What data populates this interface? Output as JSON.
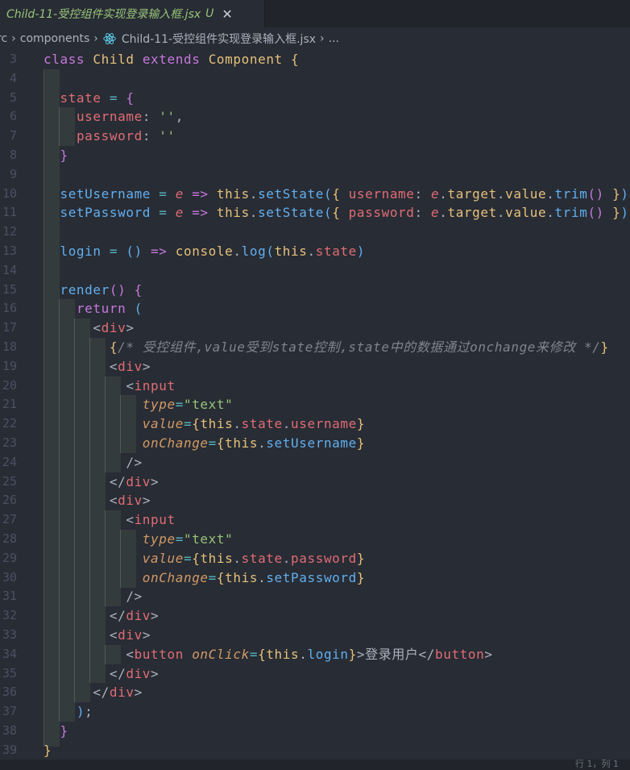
{
  "tab": {
    "title": "Child-11-受控组件实现登录输入框.jsx",
    "status": "U",
    "close_icon": "close-icon"
  },
  "breadcrumb": {
    "items": [
      "rc",
      "components",
      "Child-11-受控组件实现登录输入框.jsx",
      "..."
    ],
    "file_icon": "react-icon"
  },
  "status_bar": {
    "text": "行 1，列 1"
  },
  "editor": {
    "lines": [
      {
        "n": "3",
        "tokens": [
          [
            "k",
            "class "
          ],
          [
            "c",
            "Child "
          ],
          [
            "k",
            "extends "
          ],
          [
            "c",
            "Component "
          ],
          [
            "b1",
            "{"
          ]
        ]
      },
      {
        "n": "4",
        "tokens": []
      },
      {
        "n": "5",
        "tokens": [
          [
            "pl",
            "  "
          ],
          [
            "v",
            "state "
          ],
          [
            "o",
            "= "
          ],
          [
            "b2",
            "{"
          ]
        ]
      },
      {
        "n": "6",
        "tokens": [
          [
            "pl",
            "    "
          ],
          [
            "v",
            "username"
          ],
          [
            "pl",
            ": "
          ],
          [
            "s",
            "''"
          ],
          [
            "pl",
            ","
          ]
        ]
      },
      {
        "n": "7",
        "tokens": [
          [
            "pl",
            "    "
          ],
          [
            "v",
            "password"
          ],
          [
            "pl",
            ": "
          ],
          [
            "s",
            "''"
          ]
        ]
      },
      {
        "n": "8",
        "tokens": [
          [
            "pl",
            "  "
          ],
          [
            "b2",
            "}"
          ]
        ]
      },
      {
        "n": "9",
        "tokens": []
      },
      {
        "n": "10",
        "tokens": [
          [
            "pl",
            "  "
          ],
          [
            "f",
            "setUsername "
          ],
          [
            "o",
            "= "
          ],
          [
            "p",
            "e"
          ],
          [
            "k",
            " => "
          ],
          [
            "c",
            "this"
          ],
          [
            "pl",
            "."
          ],
          [
            "f",
            "setState"
          ],
          [
            "b3",
            "("
          ],
          [
            "b1",
            "{ "
          ],
          [
            "v",
            "username"
          ],
          [
            "pl",
            ": "
          ],
          [
            "p",
            "e"
          ],
          [
            "pl",
            "."
          ],
          [
            "c",
            "target"
          ],
          [
            "pl",
            "."
          ],
          [
            "c",
            "value"
          ],
          [
            "pl",
            "."
          ],
          [
            "f",
            "trim"
          ],
          [
            "b2",
            "() "
          ],
          [
            "b1",
            "}"
          ],
          [
            "b3",
            ")"
          ]
        ]
      },
      {
        "n": "11",
        "tokens": [
          [
            "pl",
            "  "
          ],
          [
            "f",
            "setPassword "
          ],
          [
            "o",
            "= "
          ],
          [
            "p",
            "e"
          ],
          [
            "k",
            " => "
          ],
          [
            "c",
            "this"
          ],
          [
            "pl",
            "."
          ],
          [
            "f",
            "setState"
          ],
          [
            "b3",
            "("
          ],
          [
            "b1",
            "{ "
          ],
          [
            "v",
            "password"
          ],
          [
            "pl",
            ": "
          ],
          [
            "p",
            "e"
          ],
          [
            "pl",
            "."
          ],
          [
            "c",
            "target"
          ],
          [
            "pl",
            "."
          ],
          [
            "c",
            "value"
          ],
          [
            "pl",
            "."
          ],
          [
            "f",
            "trim"
          ],
          [
            "b2",
            "() "
          ],
          [
            "b1",
            "}"
          ],
          [
            "b3",
            ")"
          ]
        ]
      },
      {
        "n": "12",
        "tokens": []
      },
      {
        "n": "13",
        "tokens": [
          [
            "pl",
            "  "
          ],
          [
            "f",
            "login "
          ],
          [
            "o",
            "= "
          ],
          [
            "b3",
            "() "
          ],
          [
            "k",
            "=> "
          ],
          [
            "c",
            "console"
          ],
          [
            "pl",
            "."
          ],
          [
            "f",
            "log"
          ],
          [
            "b3",
            "("
          ],
          [
            "c",
            "this"
          ],
          [
            "pl",
            "."
          ],
          [
            "v",
            "state"
          ],
          [
            "b3",
            ")"
          ]
        ]
      },
      {
        "n": "14",
        "tokens": []
      },
      {
        "n": "15",
        "tokens": [
          [
            "pl",
            "  "
          ],
          [
            "f",
            "render"
          ],
          [
            "b2",
            "() "
          ],
          [
            "b2",
            "{"
          ]
        ]
      },
      {
        "n": "16",
        "tokens": [
          [
            "pl",
            "    "
          ],
          [
            "k",
            "return "
          ],
          [
            "b3",
            "("
          ]
        ]
      },
      {
        "n": "17",
        "tokens": [
          [
            "pl",
            "      "
          ],
          [
            "pl",
            "<"
          ],
          [
            "t",
            "div"
          ],
          [
            "pl",
            ">"
          ]
        ]
      },
      {
        "n": "18",
        "tokens": [
          [
            "pl",
            "        "
          ],
          [
            "b1",
            "{"
          ],
          [
            "cm",
            "/* 受控组件,value受到state控制,state中的数据通过onchange来修改 */"
          ],
          [
            "b1",
            "}"
          ]
        ]
      },
      {
        "n": "19",
        "tokens": [
          [
            "pl",
            "        "
          ],
          [
            "pl",
            "<"
          ],
          [
            "t",
            "div"
          ],
          [
            "pl",
            ">"
          ]
        ]
      },
      {
        "n": "20",
        "tokens": [
          [
            "pl",
            "          "
          ],
          [
            "pl",
            "<"
          ],
          [
            "t",
            "input"
          ]
        ]
      },
      {
        "n": "21",
        "tokens": [
          [
            "pl",
            "            "
          ],
          [
            "a",
            "type"
          ],
          [
            "o",
            "="
          ],
          [
            "s",
            "\"text\""
          ]
        ]
      },
      {
        "n": "22",
        "tokens": [
          [
            "pl",
            "            "
          ],
          [
            "a",
            "value"
          ],
          [
            "o",
            "="
          ],
          [
            "b1",
            "{"
          ],
          [
            "c",
            "this"
          ],
          [
            "pl",
            "."
          ],
          [
            "v",
            "state"
          ],
          [
            "pl",
            "."
          ],
          [
            "v",
            "username"
          ],
          [
            "b1",
            "}"
          ]
        ]
      },
      {
        "n": "23",
        "tokens": [
          [
            "pl",
            "            "
          ],
          [
            "a",
            "onChange"
          ],
          [
            "o",
            "="
          ],
          [
            "b1",
            "{"
          ],
          [
            "c",
            "this"
          ],
          [
            "pl",
            "."
          ],
          [
            "f",
            "setUsername"
          ],
          [
            "b1",
            "}"
          ]
        ]
      },
      {
        "n": "24",
        "tokens": [
          [
            "pl",
            "          "
          ],
          [
            "pl",
            "/>"
          ]
        ]
      },
      {
        "n": "25",
        "tokens": [
          [
            "pl",
            "        "
          ],
          [
            "pl",
            "</"
          ],
          [
            "t",
            "div"
          ],
          [
            "pl",
            ">"
          ]
        ]
      },
      {
        "n": "26",
        "tokens": [
          [
            "pl",
            "        "
          ],
          [
            "pl",
            "<"
          ],
          [
            "t",
            "div"
          ],
          [
            "pl",
            ">"
          ]
        ]
      },
      {
        "n": "27",
        "tokens": [
          [
            "pl",
            "          "
          ],
          [
            "pl",
            "<"
          ],
          [
            "t",
            "input"
          ]
        ]
      },
      {
        "n": "28",
        "tokens": [
          [
            "pl",
            "            "
          ],
          [
            "a",
            "type"
          ],
          [
            "o",
            "="
          ],
          [
            "s",
            "\"text\""
          ]
        ]
      },
      {
        "n": "29",
        "tokens": [
          [
            "pl",
            "            "
          ],
          [
            "a",
            "value"
          ],
          [
            "o",
            "="
          ],
          [
            "b1",
            "{"
          ],
          [
            "c",
            "this"
          ],
          [
            "pl",
            "."
          ],
          [
            "v",
            "state"
          ],
          [
            "pl",
            "."
          ],
          [
            "v",
            "password"
          ],
          [
            "b1",
            "}"
          ]
        ]
      },
      {
        "n": "30",
        "tokens": [
          [
            "pl",
            "            "
          ],
          [
            "a",
            "onChange"
          ],
          [
            "o",
            "="
          ],
          [
            "b1",
            "{"
          ],
          [
            "c",
            "this"
          ],
          [
            "pl",
            "."
          ],
          [
            "f",
            "setPassword"
          ],
          [
            "b1",
            "}"
          ]
        ]
      },
      {
        "n": "31",
        "tokens": [
          [
            "pl",
            "          "
          ],
          [
            "pl",
            "/>"
          ]
        ]
      },
      {
        "n": "32",
        "tokens": [
          [
            "pl",
            "        "
          ],
          [
            "pl",
            "</"
          ],
          [
            "t",
            "div"
          ],
          [
            "pl",
            ">"
          ]
        ]
      },
      {
        "n": "33",
        "tokens": [
          [
            "pl",
            "        "
          ],
          [
            "pl",
            "<"
          ],
          [
            "t",
            "div"
          ],
          [
            "pl",
            ">"
          ]
        ]
      },
      {
        "n": "34",
        "tokens": [
          [
            "pl",
            "          "
          ],
          [
            "pl",
            "<"
          ],
          [
            "t",
            "button "
          ],
          [
            "a",
            "onClick"
          ],
          [
            "o",
            "="
          ],
          [
            "b1",
            "{"
          ],
          [
            "c",
            "this"
          ],
          [
            "pl",
            "."
          ],
          [
            "f",
            "login"
          ],
          [
            "b1",
            "}"
          ],
          [
            "pl",
            ">"
          ],
          [
            "tx",
            "登录用户"
          ],
          [
            "pl",
            "</"
          ],
          [
            "t",
            "button"
          ],
          [
            "pl",
            ">"
          ]
        ]
      },
      {
        "n": "35",
        "tokens": [
          [
            "pl",
            "        "
          ],
          [
            "pl",
            "</"
          ],
          [
            "t",
            "div"
          ],
          [
            "pl",
            ">"
          ]
        ]
      },
      {
        "n": "36",
        "tokens": [
          [
            "pl",
            "      "
          ],
          [
            "pl",
            "</"
          ],
          [
            "t",
            "div"
          ],
          [
            "pl",
            ">"
          ]
        ]
      },
      {
        "n": "37",
        "tokens": [
          [
            "pl",
            "    "
          ],
          [
            "b3",
            ")"
          ],
          [
            "pl",
            ";"
          ]
        ]
      },
      {
        "n": "38",
        "tokens": [
          [
            "pl",
            "  "
          ],
          [
            "b2",
            "}"
          ]
        ]
      },
      {
        "n": "39",
        "tokens": [
          [
            "b1",
            "}"
          ]
        ]
      }
    ]
  }
}
